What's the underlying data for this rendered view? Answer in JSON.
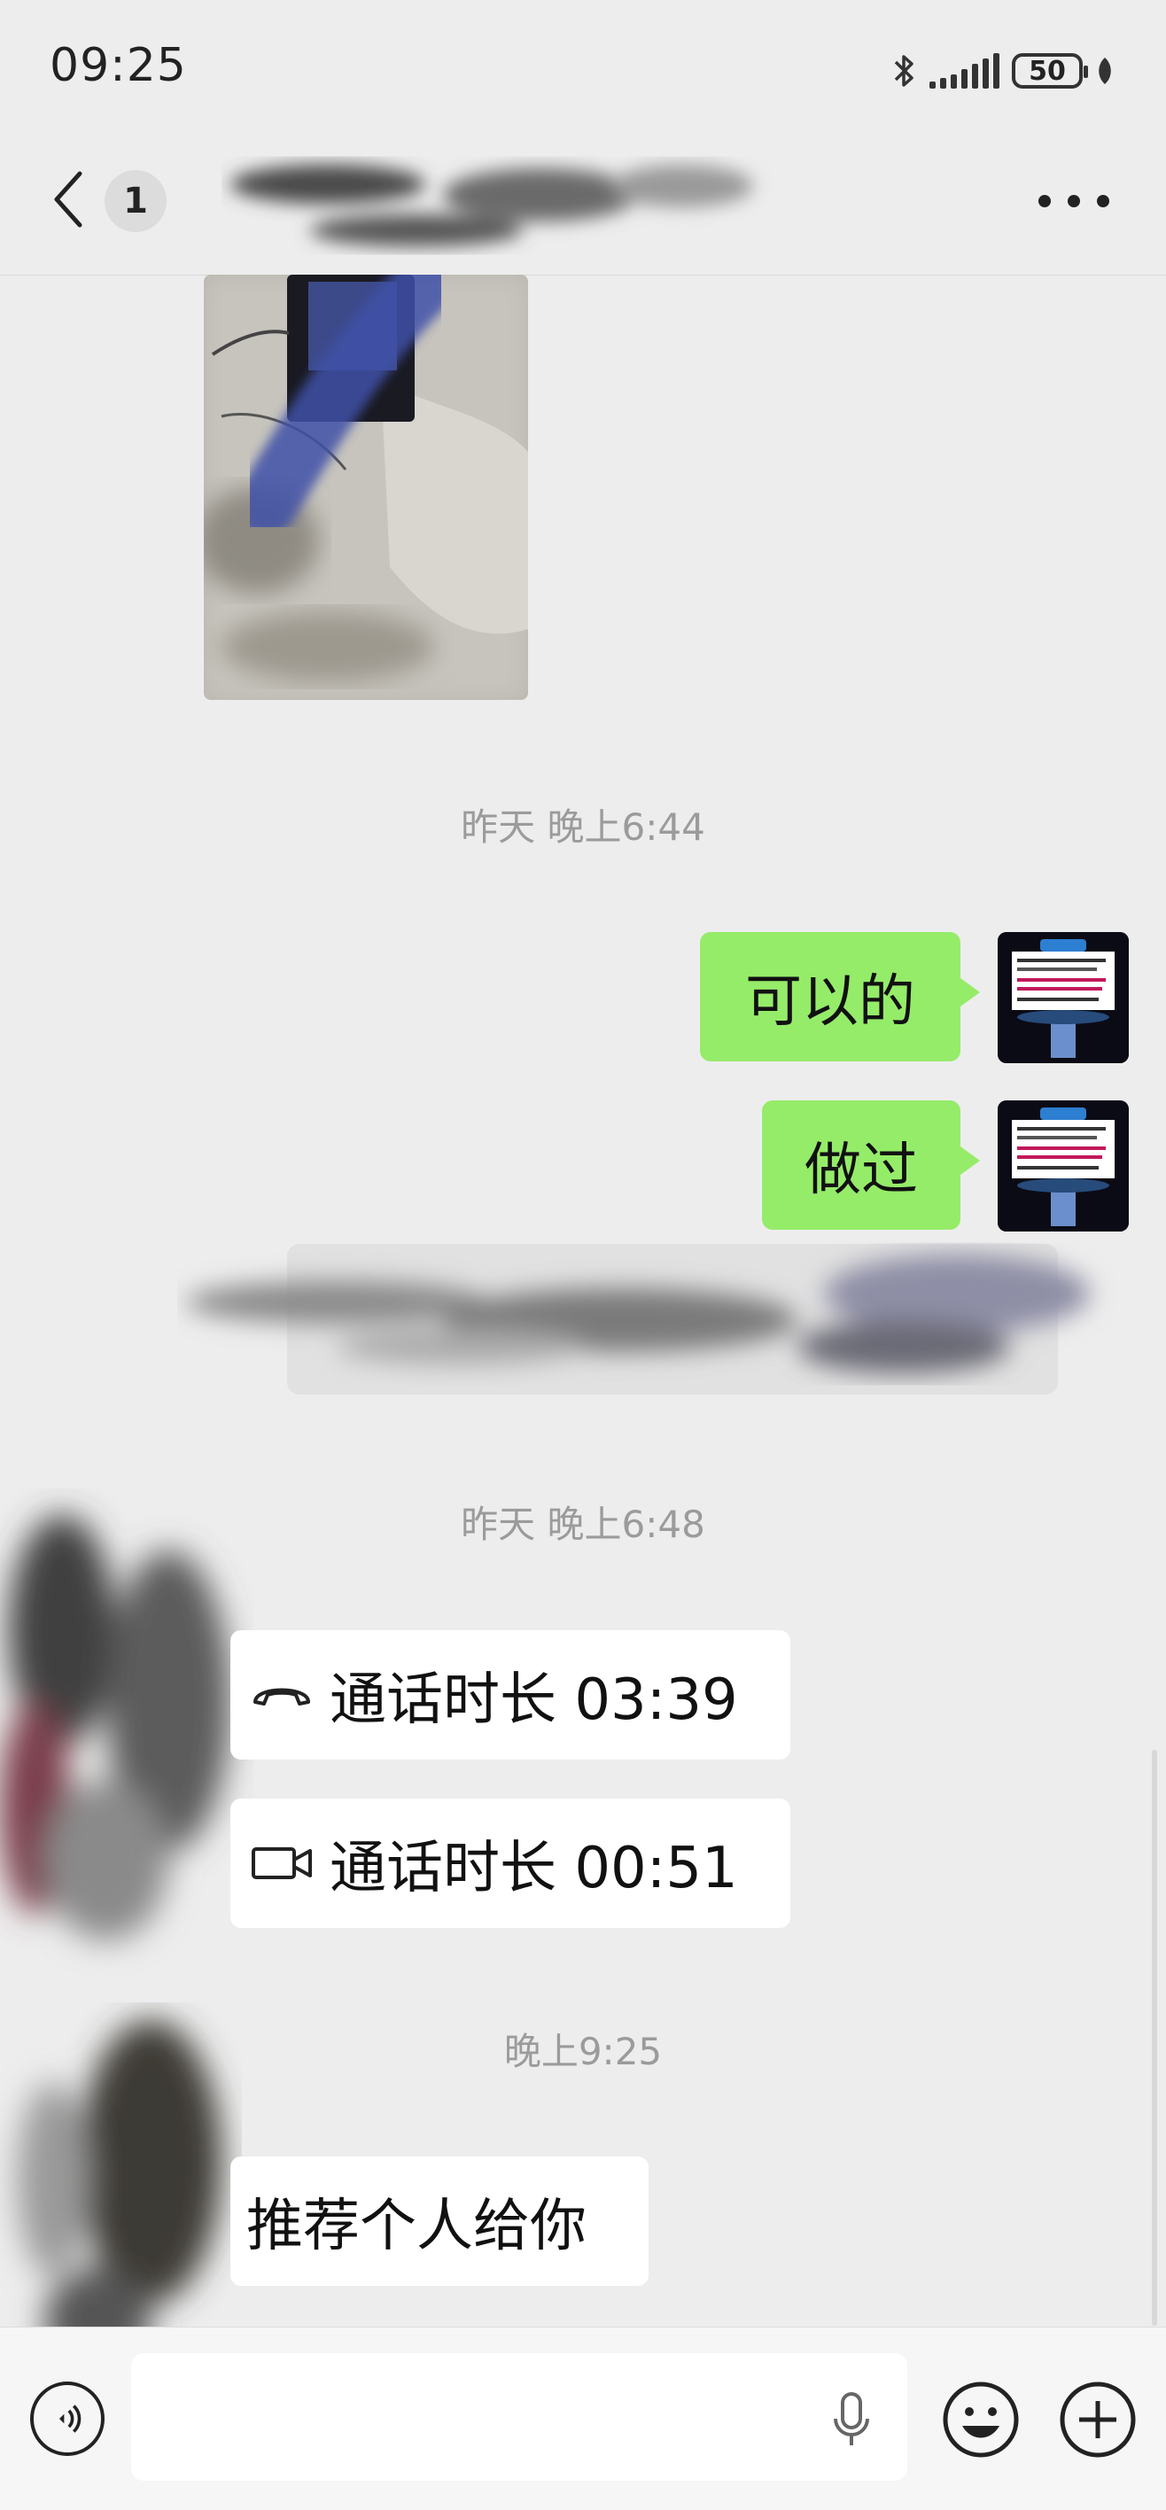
{
  "status_bar": {
    "time": "09:25",
    "battery": "50",
    "icons": [
      "bluetooth-icon",
      "signal-icon",
      "battery-icon",
      "leaf-icon"
    ]
  },
  "header": {
    "unread_count": "1",
    "icons": [
      "back-arrow-icon",
      "more-icon"
    ]
  },
  "messages": {
    "time_1": "昨天 晚上6:44",
    "sent_1": "可以的",
    "sent_2": "做过",
    "time_2": "昨天 晚上6:48",
    "call_voice": "通话时长 03:39",
    "call_video": "通话时长 00:51",
    "time_3": "晚上9:25",
    "received_recommend": "推荐个人给你"
  },
  "input_bar": {
    "icons": [
      "voice-icon",
      "mic-icon",
      "emoji-icon",
      "add-icon"
    ]
  },
  "colors": {
    "background": "#ededed",
    "sent_bubble": "#95ec69",
    "received_bubble": "#ffffff",
    "timestamp": "#9b9b9b"
  }
}
